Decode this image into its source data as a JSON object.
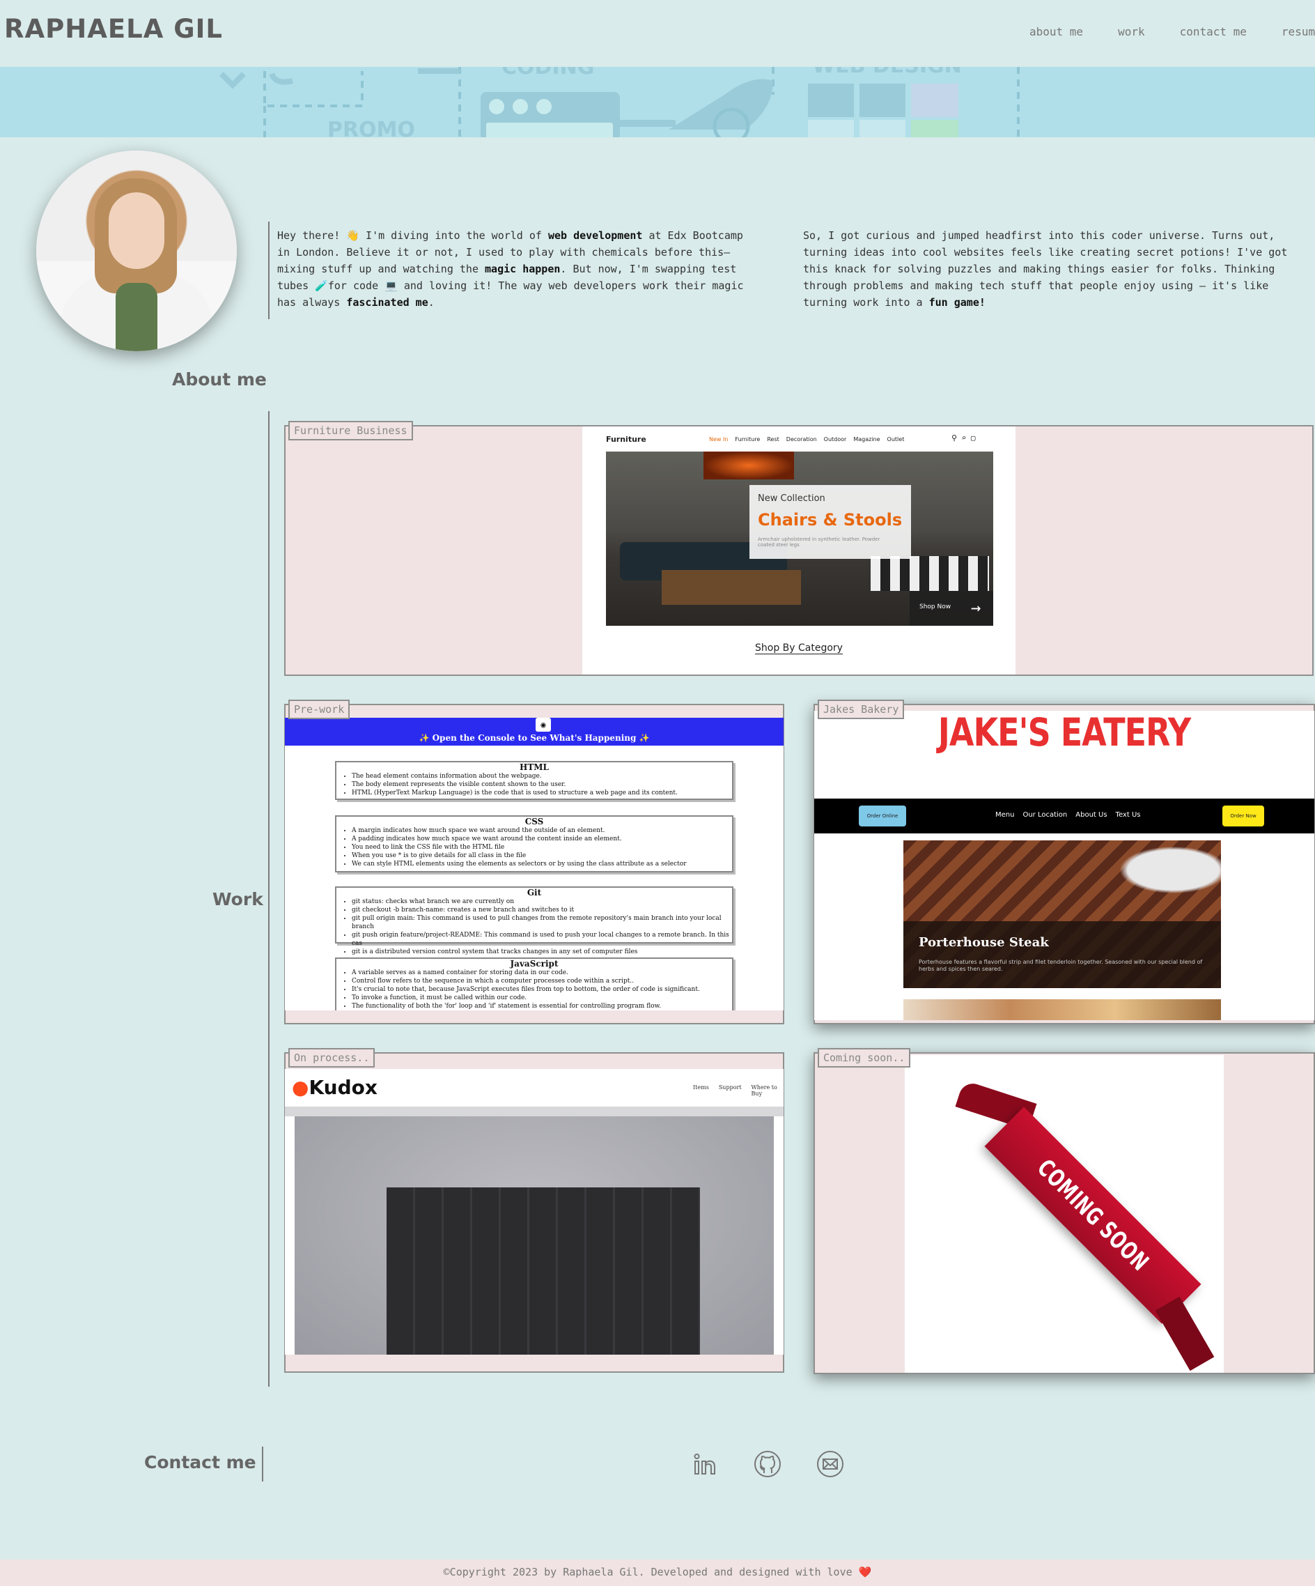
{
  "header": {
    "logo": "RAPHAELA GIL",
    "nav": [
      "about me",
      "work",
      "contact me",
      "resume"
    ]
  },
  "banner": {
    "words": [
      "CODING",
      "PROMO",
      "WEB DESIGN"
    ]
  },
  "about": {
    "label": "About me",
    "p1": [
      {
        "t": "Hey there! 👋 I'm diving into the world of ",
        "b": false
      },
      {
        "t": "web development",
        "b": true
      },
      {
        "t": " at Edx Bootcamp\nin London. Believe it or not, I used to play with chemicals before this—\nmixing stuff up and watching the ",
        "b": false
      },
      {
        "t": "magic happen",
        "b": true
      },
      {
        "t": ". But now, I'm swapping test\ntubes 🧪for code 💻 and loving it! The way web developers work their magic\nhas always ",
        "b": false
      },
      {
        "t": "fascinated me",
        "b": true
      },
      {
        "t": ".",
        "b": false
      }
    ],
    "p2": [
      {
        "t": "So, I got curious and jumped headfirst into this coder universe. Turns out,\nturning ideas into cool websites feels like creating secret potions! I've got\nthis knack for solving puzzles and making things easier for folks. Thinking\nthrough problems and making tech stuff that people enjoy using — it's like\nturning work into a ",
        "b": false
      },
      {
        "t": "fun game!",
        "b": true
      }
    ]
  },
  "work": {
    "label": "Work",
    "cards": {
      "furniture": {
        "tag": "Furniture Business",
        "brand": "Furniture",
        "menu": [
          "New In",
          "Furniture",
          "Rest",
          "Decoration",
          "Outdoor",
          "Magazine",
          "Outlet"
        ],
        "collection": "New Collection",
        "headline": "Chairs & Stools",
        "desc": "Armchair upholstered in synthetic leather. Powder coated steel legs",
        "shop": "Shop Now",
        "category": "Shop By Category"
      },
      "prework": {
        "tag": "Pre-work",
        "banner": "✨ Open the Console to See What's Happening ✨",
        "sections": [
          {
            "title": "HTML",
            "items": [
              "The head element contains information about the webpage.",
              "The body element represents the visible content shown to the user.",
              "HTML (HyperText Markup Language) is the code that is used to structure a web page and its content."
            ]
          },
          {
            "title": "CSS",
            "items": [
              "A margin indicates how much space we want around the outside of an element.",
              "A padding indicates how much space we want around the content inside an element.",
              "You need to link the CSS file with the HTML file",
              "When you use * is to give details for all class in the file",
              "We can style HTML elements using the elements as selectors or by using the class attribute as a selector"
            ]
          },
          {
            "title": "Git",
            "items": [
              "git status: checks what branch we are currently on",
              "git checkout -b branch-name: creates a new branch and switches to it",
              "git pull origin main: This command is used to pull changes from the remote repository's main branch into your local branch",
              "git push origin feature/project-README: This command is used to push your local changes to a remote branch. In this cas",
              "git is a distributed version control system that tracks changes in any set of computer files"
            ]
          },
          {
            "title": "JavaScript",
            "items": [
              "A variable serves as a named container for storing data in our code.",
              "Control flow refers to the sequence in which a computer processes code within a script..",
              "It's crucial to note that, because JavaScript executes files from top to bottom, the order of code is significant.",
              "To invoke a function, it must be called within our code.",
              "The functionality of both the 'for' loop and 'if' statement is essential for controlling program flow."
            ]
          }
        ]
      },
      "jakes": {
        "tag": "Jakes Bakery",
        "title": "JAKE'S EATERY",
        "order_online": "Order Online",
        "links": [
          "Menu",
          "Our Location",
          "About Us",
          "Text Us"
        ],
        "order_now": "Order Now",
        "dish": "Porterhouse Steak",
        "dish_desc": "Porterhouse features a flavorful strip and filet tenderloin together. Seasoned with our special blend of herbs and spices then seared."
      },
      "kudox": {
        "tag": "On process..",
        "logo": "Kudox",
        "nav": [
          "Items",
          "Support",
          "Where to Buy"
        ]
      },
      "soon": {
        "tag": "Coming soon..",
        "ribbon": "COMING SOON"
      }
    }
  },
  "contact": {
    "label": "Contact me",
    "icons": [
      "linkedin-icon",
      "github-icon",
      "email-icon"
    ]
  },
  "footer": {
    "text": "©Copyright 2023 by Raphaela Gil. Developed and designed with love ❤️"
  },
  "colors": {
    "background": "#d9ebea",
    "banner": "#b0dfea",
    "card": "#f1e3e3",
    "accent_orange": "#e8680f",
    "jake_red": "#e83030"
  }
}
